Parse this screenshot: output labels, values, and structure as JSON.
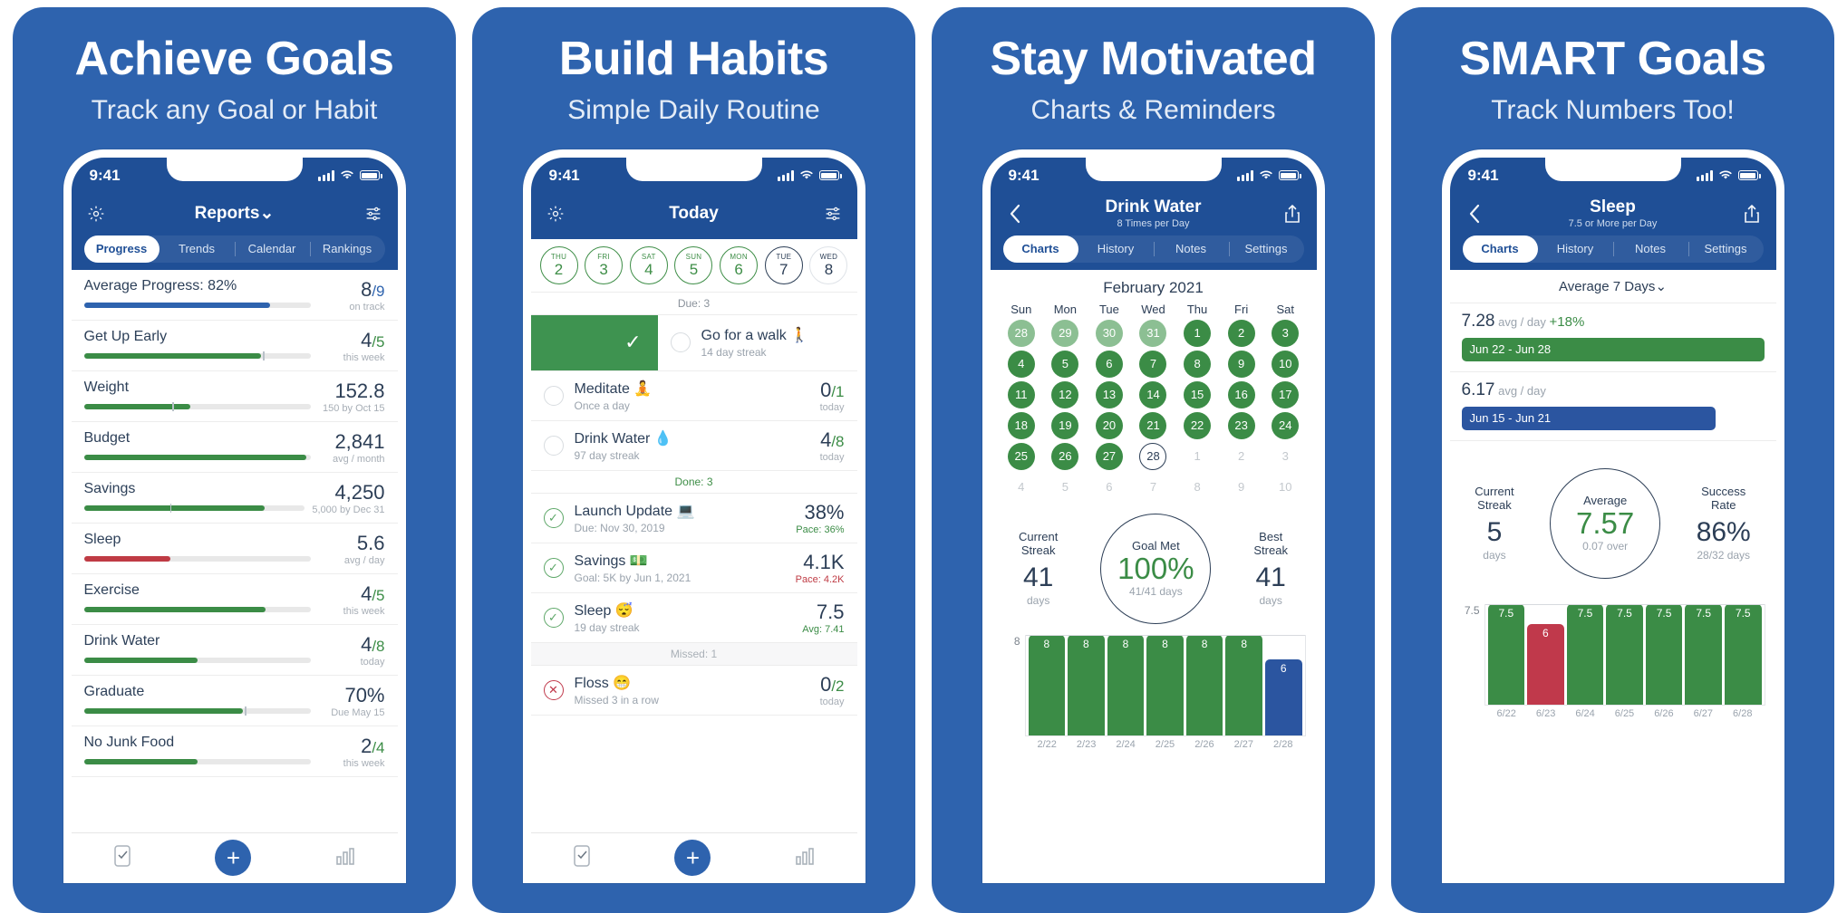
{
  "panels": [
    {
      "headline": "Achieve Goals",
      "subhead": "Track any Goal or Habit",
      "status": {
        "time": "9:41"
      },
      "nav": {
        "title": "Reports",
        "caret": "⌄",
        "left_icon": "gear-icon",
        "right_icon": "sliders-icon"
      },
      "tabs": [
        {
          "label": "Progress",
          "active": true
        },
        {
          "label": "Trends",
          "active": false
        },
        {
          "label": "Calendar",
          "active": false
        },
        {
          "label": "Rankings",
          "active": false
        }
      ],
      "rows": [
        {
          "title": "Average Progress: 82%",
          "value": "",
          "denom": "",
          "sub": "8/9",
          "vsub": "on track",
          "vmain": "8",
          "vdenom": "/9",
          "pct": 82,
          "color": "#2e63ae",
          "marker": 0
        },
        {
          "title": "Get Up Early",
          "vmain": "4",
          "vdenom": "/5",
          "vsub": "this week",
          "pct": 78,
          "color": "#3b8c46",
          "marker": 79
        },
        {
          "title": "Weight",
          "vmain": "152.8",
          "vdenom": "",
          "vsub": "150 by Oct 15",
          "pct": 47,
          "color": "#3b8c46",
          "marker": 39
        },
        {
          "title": "Budget",
          "vmain": "2,841",
          "vdenom": "",
          "vsub": "avg / month",
          "pct": 98,
          "color": "#3b8c46",
          "marker": 0
        },
        {
          "title": "Savings",
          "vmain": "4,250",
          "vdenom": "",
          "vsub": "5,000 by Dec 31",
          "pct": 82,
          "color": "#3b8c46",
          "marker": 39
        },
        {
          "title": "Sleep",
          "vmain": "5.6",
          "vdenom": "",
          "vsub": "avg / day",
          "pct": 38,
          "color": "#bf3b44",
          "marker": 0
        },
        {
          "title": "Exercise",
          "vmain": "4",
          "vdenom": "/5",
          "vsub": "this week",
          "pct": 80,
          "color": "#3b8c46",
          "marker": 0
        },
        {
          "title": "Drink Water",
          "vmain": "4",
          "vdenom": "/8",
          "vsub": "today",
          "pct": 50,
          "color": "#3b8c46",
          "marker": 0
        },
        {
          "title": "Graduate",
          "vmain": "70%",
          "vdenom": "",
          "vsub": "Due May 15",
          "pct": 70,
          "color": "#3b8c46",
          "marker": 71
        },
        {
          "title": "No Junk Food",
          "vmain": "2",
          "vdenom": "/4",
          "vsub": "this week",
          "pct": 50,
          "color": "#3b8c46",
          "marker": 0
        }
      ],
      "tabbar": {
        "left": "checklist-icon",
        "center": "+",
        "right": "bar-chart-icon"
      }
    },
    {
      "headline": "Build Habits",
      "subhead": "Simple Daily Routine",
      "status": {
        "time": "9:41"
      },
      "nav": {
        "title": "Today",
        "left_icon": "gear-icon",
        "right_icon": "sliders-icon"
      },
      "week": [
        {
          "dow": "THU",
          "day": "2",
          "state": "done"
        },
        {
          "dow": "FRI",
          "day": "3",
          "state": "done"
        },
        {
          "dow": "SAT",
          "day": "4",
          "state": "done"
        },
        {
          "dow": "SUN",
          "day": "5",
          "state": "done"
        },
        {
          "dow": "MON",
          "day": "6",
          "state": "done"
        },
        {
          "dow": "TUE",
          "day": "7",
          "state": "today"
        },
        {
          "dow": "WED",
          "day": "8",
          "state": "future"
        }
      ],
      "sections": [
        {
          "label": "Due: 3",
          "kind": "due"
        },
        {
          "label": "Done: 3",
          "kind": "done"
        },
        {
          "label": "Missed: 1",
          "kind": "missed"
        }
      ],
      "due_items": [
        {
          "title": "Go for a walk 🚶",
          "sub": "14 day streak",
          "vmain": "",
          "vdenom": "",
          "vsub": "",
          "swipe": true,
          "swipe_glyph": "✓"
        },
        {
          "title": "Meditate 🧘",
          "sub": "Once a day",
          "vmain": "0",
          "vdenom": "/1",
          "vsub": "today",
          "state": "open"
        },
        {
          "title": "Drink Water 💧",
          "sub": "97 day streak",
          "vmain": "4",
          "vdenom": "/8",
          "vsub": "today",
          "state": "open"
        }
      ],
      "done_items": [
        {
          "title": "Launch Update 💻",
          "sub": "Due: Nov 30, 2019",
          "vmain": "38%",
          "vdenom": "",
          "vsub": "Pace: 36%",
          "vsub_color": "#3b8c46",
          "state": "done"
        },
        {
          "title": "Savings 💵",
          "sub": "Goal: 5K by Jun 1, 2021",
          "vmain": "4.1K",
          "vdenom": "",
          "vsub": "Pace: 4.2K",
          "vsub_color": "#bf3b44",
          "state": "done"
        },
        {
          "title": "Sleep 😴",
          "sub": "19 day streak",
          "vmain": "7.5",
          "vdenom": "",
          "vsub": "Avg: 7.41",
          "vsub_color": "#3b8c46",
          "state": "done"
        }
      ],
      "missed_items": [
        {
          "title": "Floss 😁",
          "sub": "Missed 3 in a row",
          "vmain": "0",
          "vdenom": "/2",
          "vsub": "today",
          "state": "missed"
        }
      ],
      "tabbar": {
        "left": "checklist-icon",
        "center": "+",
        "right": "bar-chart-icon"
      }
    },
    {
      "headline": "Stay Motivated",
      "subhead": "Charts & Reminders",
      "status": {
        "time": "9:41"
      },
      "nav": {
        "title": "Drink Water",
        "sub": "8 Times per Day",
        "left_icon": "back-chevron-icon",
        "right_icon": "share-icon"
      },
      "tabs": [
        {
          "label": "Charts",
          "active": true
        },
        {
          "label": "History",
          "active": false
        },
        {
          "label": "Notes",
          "active": false
        },
        {
          "label": "Settings",
          "active": false
        }
      ],
      "calendar": {
        "month": "February 2021",
        "headers": [
          "Sun",
          "Mon",
          "Tue",
          "Wed",
          "Thu",
          "Fri",
          "Sat"
        ],
        "cells": [
          {
            "d": "28",
            "s": "gl"
          },
          {
            "d": "29",
            "s": "gl"
          },
          {
            "d": "30",
            "s": "gl"
          },
          {
            "d": "31",
            "s": "gl"
          },
          {
            "d": "1",
            "s": "g"
          },
          {
            "d": "2",
            "s": "g"
          },
          {
            "d": "3",
            "s": "g"
          },
          {
            "d": "4",
            "s": "g"
          },
          {
            "d": "5",
            "s": "g"
          },
          {
            "d": "6",
            "s": "g"
          },
          {
            "d": "7",
            "s": "g"
          },
          {
            "d": "8",
            "s": "g"
          },
          {
            "d": "9",
            "s": "g"
          },
          {
            "d": "10",
            "s": "g"
          },
          {
            "d": "11",
            "s": "g"
          },
          {
            "d": "12",
            "s": "g"
          },
          {
            "d": "13",
            "s": "g"
          },
          {
            "d": "14",
            "s": "g"
          },
          {
            "d": "15",
            "s": "g"
          },
          {
            "d": "16",
            "s": "g"
          },
          {
            "d": "17",
            "s": "g"
          },
          {
            "d": "18",
            "s": "g"
          },
          {
            "d": "19",
            "s": "g"
          },
          {
            "d": "20",
            "s": "g"
          },
          {
            "d": "21",
            "s": "g"
          },
          {
            "d": "22",
            "s": "g"
          },
          {
            "d": "23",
            "s": "g"
          },
          {
            "d": "24",
            "s": "g"
          },
          {
            "d": "25",
            "s": "g"
          },
          {
            "d": "26",
            "s": "g"
          },
          {
            "d": "27",
            "s": "g"
          },
          {
            "d": "28",
            "s": "today"
          },
          {
            "d": "1",
            "s": "out"
          },
          {
            "d": "2",
            "s": "out"
          },
          {
            "d": "3",
            "s": "out"
          },
          {
            "d": "4",
            "s": "out"
          },
          {
            "d": "5",
            "s": "out"
          },
          {
            "d": "6",
            "s": "out"
          },
          {
            "d": "7",
            "s": "out"
          },
          {
            "d": "8",
            "s": "out"
          },
          {
            "d": "9",
            "s": "out"
          },
          {
            "d": "10",
            "s": "out"
          }
        ]
      },
      "stats": {
        "left_label": "Current\nStreak",
        "left_big": "41",
        "left_sub": "days",
        "center_label": "Goal Met",
        "center_big": "100%",
        "center_sub": "41/41 days",
        "right_label": "Best\nStreak",
        "right_big": "41",
        "right_sub": "days"
      },
      "chart_data": {
        "type": "bar",
        "title": "Drink Water — last 7 days",
        "categories": [
          "2/22",
          "2/23",
          "2/24",
          "2/25",
          "2/26",
          "2/27",
          "2/28"
        ],
        "values": [
          8,
          8,
          8,
          8,
          8,
          8,
          6
        ],
        "colors": [
          "#3b8c46",
          "#3b8c46",
          "#3b8c46",
          "#3b8c46",
          "#3b8c46",
          "#3b8c46",
          "#2b55a0"
        ],
        "ylabel": "",
        "xlabel": "",
        "ylim": [
          0,
          8
        ],
        "ymax_label": "8",
        "grid": false,
        "legend": false
      }
    },
    {
      "headline": "SMART Goals",
      "subhead": "Track Numbers Too!",
      "status": {
        "time": "9:41"
      },
      "nav": {
        "title": "Sleep",
        "sub": "7.5 or More per Day",
        "left_icon": "back-chevron-icon",
        "right_icon": "share-icon"
      },
      "tabs": [
        {
          "label": "Charts",
          "active": true
        },
        {
          "label": "History",
          "active": false
        },
        {
          "label": "Notes",
          "active": false
        },
        {
          "label": "Settings",
          "active": false
        }
      ],
      "avg_header": "Average 7 Days",
      "avg_caret": "⌄",
      "avg_rows": [
        {
          "num": "7.28",
          "unit": "avg / day",
          "pct": "+18%",
          "range": "Jun 22 - Jun 28",
          "width": 100,
          "color": "#3b8c46"
        },
        {
          "num": "6.17",
          "unit": "avg / day",
          "pct": "",
          "range": "Jun 15 - Jun 21",
          "width": 84,
          "color": "#2b55a0"
        }
      ],
      "stats": {
        "left_label": "Current\nStreak",
        "left_big": "5",
        "left_sub": "days",
        "center_label": "Average",
        "center_big": "7.57",
        "center_sub": "0.07 over",
        "right_label": "Success\nRate",
        "right_big": "86%",
        "right_sub": "28/32 days"
      },
      "chart_data": {
        "type": "bar",
        "title": "Sleep — last 7 days",
        "categories": [
          "6/22",
          "6/23",
          "6/24",
          "6/25",
          "6/26",
          "6/27",
          "6/28"
        ],
        "values": [
          7.5,
          6,
          7.5,
          7.5,
          7.5,
          7.5,
          7.5
        ],
        "colors": [
          "#3b8c46",
          "#c0394b",
          "#3b8c46",
          "#3b8c46",
          "#3b8c46",
          "#3b8c46",
          "#3b8c46"
        ],
        "ylabel": "",
        "xlabel": "",
        "ylim": [
          0,
          7.5
        ],
        "ymax_label": "7.5",
        "grid": false,
        "legend": false
      }
    }
  ]
}
